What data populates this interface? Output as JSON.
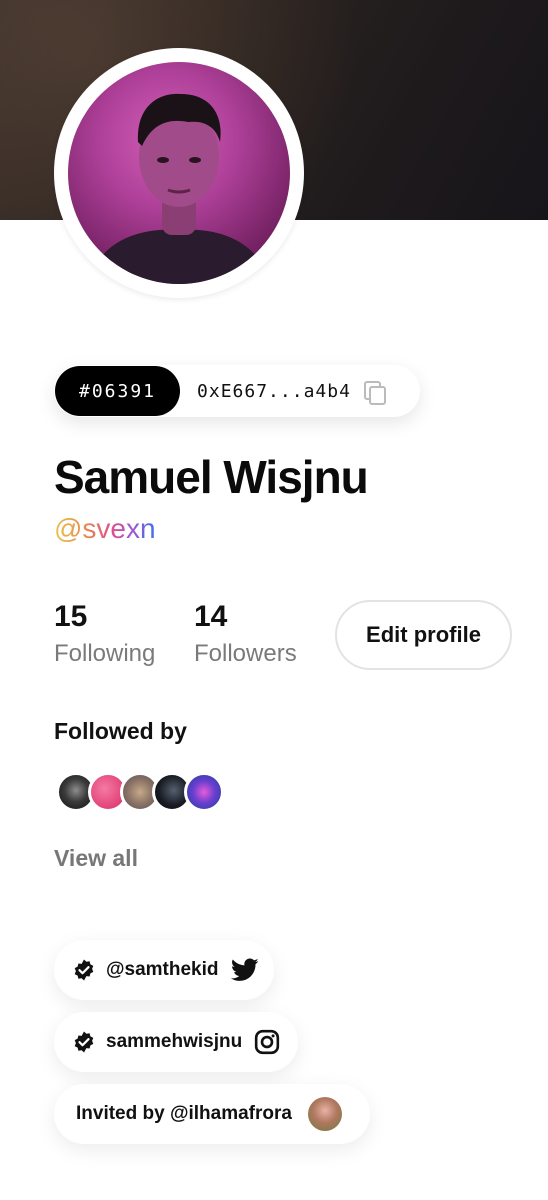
{
  "profile": {
    "token_id": "#06391",
    "wallet_address": "0xE667...a4b4",
    "name": "Samuel Wisjnu",
    "handle": "@svexn"
  },
  "stats": {
    "following_count": "15",
    "following_label": "Following",
    "followers_count": "14",
    "followers_label": "Followers"
  },
  "actions": {
    "edit_profile_label": "Edit profile",
    "view_all_label": "View all"
  },
  "followed_by": {
    "heading": "Followed by"
  },
  "socials": {
    "twitter_handle": "@samthekid",
    "instagram_handle": "sammehwisjnu",
    "invited_by_text": "Invited by @ilhamafrora"
  },
  "icons": [
    "copy-icon",
    "verified-icon",
    "twitter-icon",
    "instagram-icon"
  ],
  "colors": {
    "banner": "#2a2320",
    "token_tag_bg": "#000000",
    "handle_gradient": [
      "#e8c44c",
      "#e98a4a",
      "#e0508a",
      "#9b58d6",
      "#3a72e8"
    ],
    "muted_text": "#7a7a7a"
  }
}
